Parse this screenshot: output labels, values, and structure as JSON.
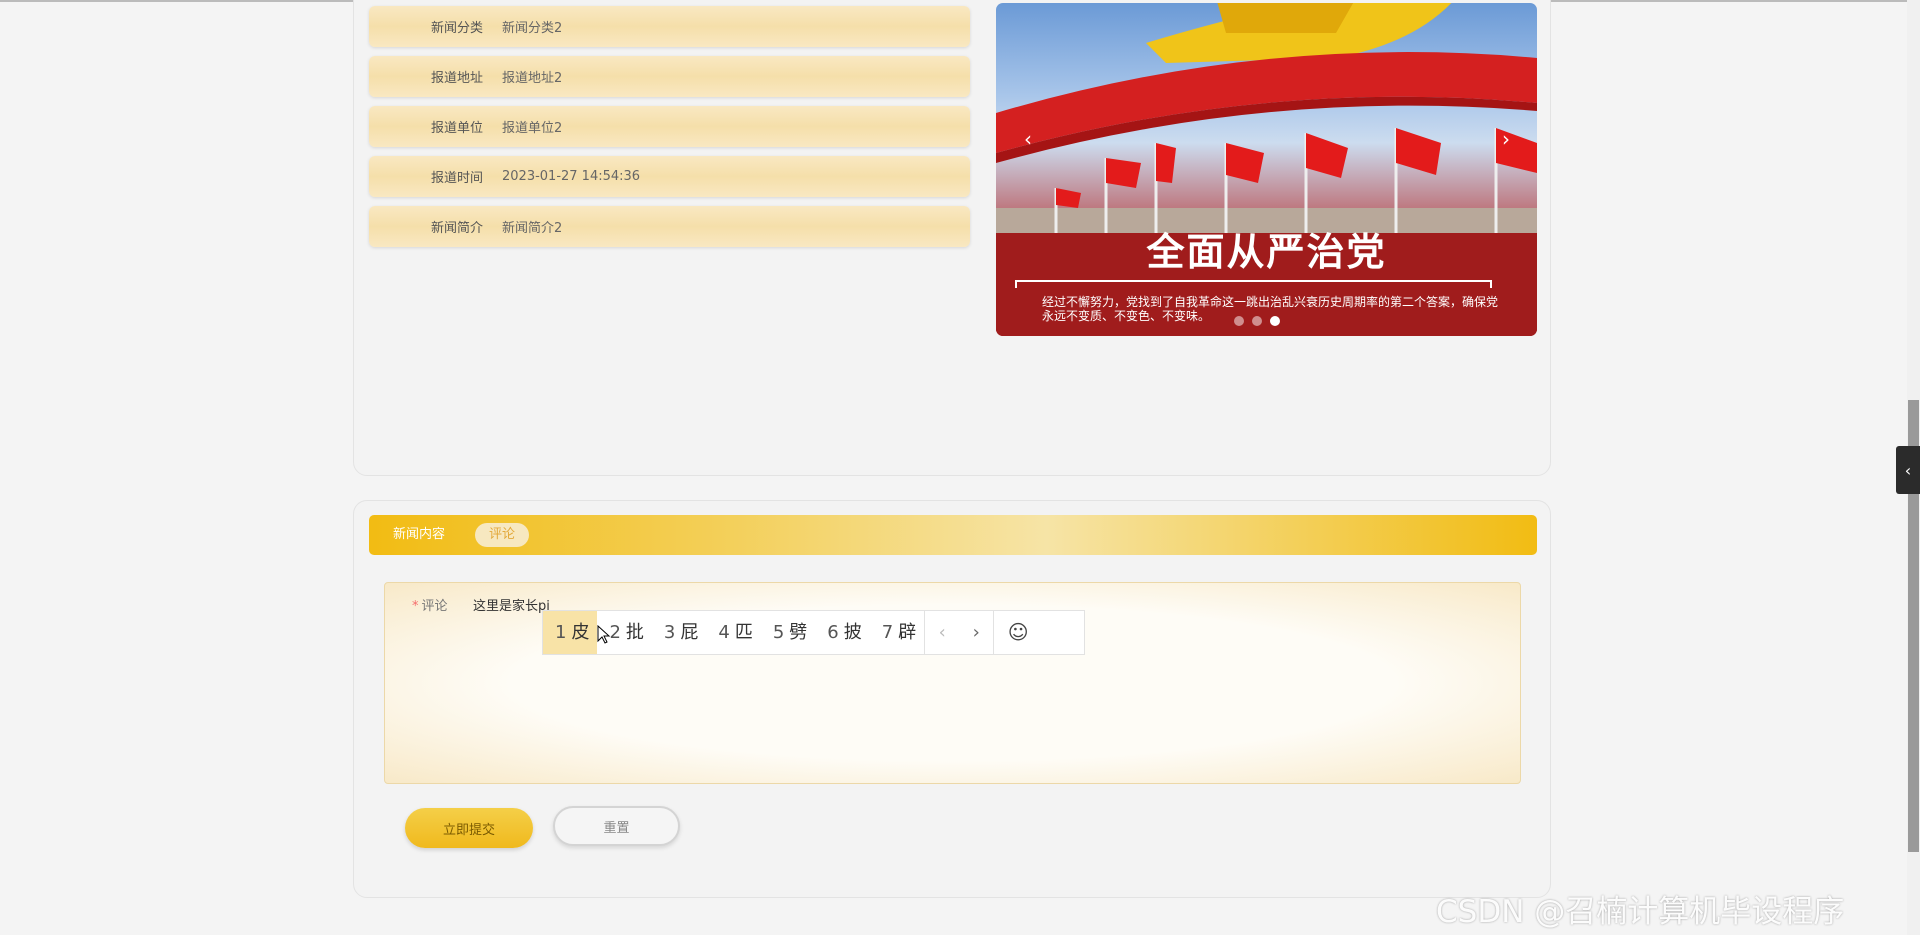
{
  "detail": {
    "rows": [
      {
        "label": "新闻分类",
        "value": "新闻分类2"
      },
      {
        "label": "报道地址",
        "value": "报道地址2"
      },
      {
        "label": "报道单位",
        "value": "报道单位2"
      },
      {
        "label": "报道时间",
        "value": "2023-01-27 14:54:36"
      },
      {
        "label": "新闻简介",
        "value": "新闻简介2"
      }
    ]
  },
  "carousel": {
    "headline": "全面从严治党",
    "subtitle": "经过不懈努力，党找到了自我革命这一跳出治乱兴衰历史周期率的第二个答案，确保党永远不变质、不变色、不变味。",
    "prev_icon": "‹",
    "next_icon": "›",
    "active_dot": 3
  },
  "tabs": {
    "content_label": "新闻内容",
    "comment_label": "评论"
  },
  "comment_form": {
    "required_mark": "*",
    "label": "评论",
    "value": "这里是家长pi",
    "submit_label": "立即提交",
    "reset_label": "重置"
  },
  "ime": {
    "candidates": [
      {
        "num": "1",
        "char": "皮"
      },
      {
        "num": "2",
        "char": "批"
      },
      {
        "num": "3",
        "char": "屁"
      },
      {
        "num": "4",
        "char": "匹"
      },
      {
        "num": "5",
        "char": "劈"
      },
      {
        "num": "6",
        "char": "披"
      },
      {
        "num": "7",
        "char": "辟"
      }
    ],
    "prev_icon": "‹",
    "next_icon": "›",
    "emoji_icon": "☺"
  },
  "side_toggle_icon": "‹",
  "watermark": "CSDN @召楠计算机毕设程序"
}
